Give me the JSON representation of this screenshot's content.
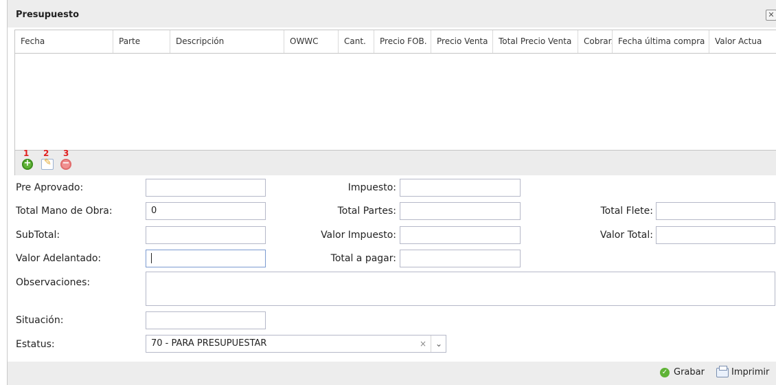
{
  "dialog": {
    "title": "Presupuesto",
    "close_glyph": "✕"
  },
  "grid": {
    "columns": [
      "Fecha",
      "Parte",
      "Descripción",
      "OWWC",
      "Cant.",
      "Precio FOB.",
      "Precio Venta",
      "Total Precio Venta",
      "Cobrar.",
      "Fecha última compra",
      "Valor Actua"
    ],
    "rows": []
  },
  "toolbar": {
    "add_number": "1",
    "edit_number": "2",
    "delete_number": "3",
    "icons": [
      "add-icon",
      "edit-icon",
      "delete-icon"
    ],
    "marker_color": "#e02020"
  },
  "form": {
    "pre_aprovado": {
      "label": "Pre Aprovado:",
      "value": ""
    },
    "impuesto": {
      "label": "Impuesto:",
      "value": ""
    },
    "total_mano_obra": {
      "label": "Total Mano de Obra:",
      "value": "0"
    },
    "total_partes": {
      "label": "Total Partes:",
      "value": ""
    },
    "total_flete": {
      "label": "Total Flete:",
      "value": ""
    },
    "subtotal": {
      "label": "SubTotal:",
      "value": ""
    },
    "valor_impuesto": {
      "label": "Valor Impuesto:",
      "value": ""
    },
    "valor_total": {
      "label": "Valor Total:",
      "value": ""
    },
    "valor_adelantado": {
      "label": "Valor Adelantado:",
      "value": ""
    },
    "total_a_pagar": {
      "label": "Total a pagar:",
      "value": ""
    },
    "observaciones": {
      "label": "Observaciones:",
      "value": ""
    },
    "situacion": {
      "label": "Situación:",
      "value": ""
    },
    "estatus": {
      "label": "Estatus:",
      "value": "70 - PARA PRESUPUESTAR",
      "clear_glyph": "×",
      "dropdown_glyph": "⌄"
    }
  },
  "footer": {
    "save_label": "Grabar",
    "print_label": "Imprimir"
  }
}
